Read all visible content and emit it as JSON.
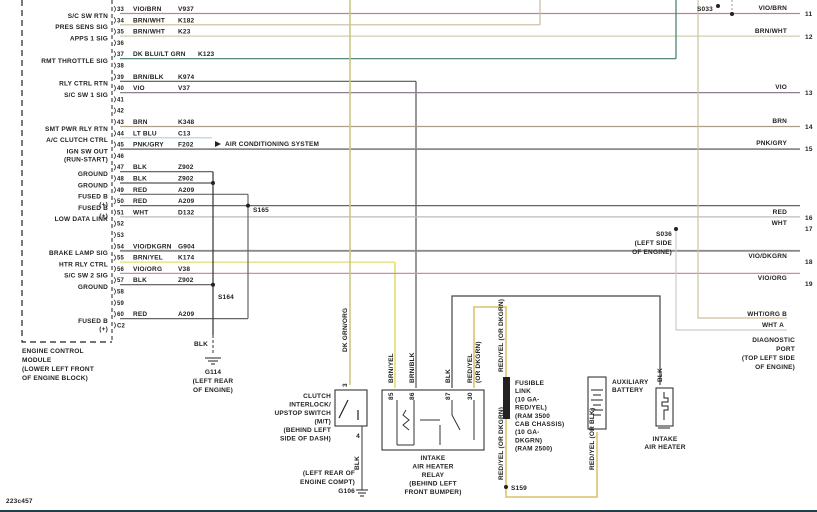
{
  "ecm": {
    "pins": [
      {
        "pin": "33",
        "name": "",
        "wire": "VIO/BRN",
        "circuit": "V937",
        "hex": "#b4869c"
      },
      {
        "pin": "34",
        "name": "S/C SW RTN",
        "wire": "BRN/WHT",
        "circuit": "K182",
        "hex": "#c9bc9c"
      },
      {
        "pin": "35",
        "name": "PRES SENS SIG",
        "wire": "BRN/WHT",
        "circuit": "K23",
        "hex": "#d6ccb4"
      },
      {
        "pin": "36",
        "name": "APPS 1 SIG",
        "wire": "",
        "circuit": "",
        "hex": ""
      },
      {
        "pin": "37",
        "name": "",
        "wire": "DK BLU/LT GRN",
        "circuit": "K123",
        "hex": "#3f7a6a"
      },
      {
        "pin": "38",
        "name": "RMT THROTTLE SIG",
        "wire": "",
        "circuit": "",
        "hex": ""
      },
      {
        "pin": "39",
        "name": "",
        "wire": "BRN/BLK",
        "circuit": "K974",
        "hex": "#555555"
      },
      {
        "pin": "40",
        "name": "RLY CTRL RTN",
        "wire": "VIO",
        "circuit": "V37",
        "hex": "#8e7f8e"
      },
      {
        "pin": "41",
        "name": "S/C SW 1 SIG",
        "wire": "",
        "circuit": "",
        "hex": ""
      },
      {
        "pin": "42",
        "name": "",
        "wire": "",
        "circuit": "",
        "hex": ""
      },
      {
        "pin": "43",
        "name": "",
        "wire": "BRN",
        "circuit": "K348",
        "hex": "#ab9e8c"
      },
      {
        "pin": "44",
        "name": "SMT PWR RLY RTN",
        "wire": "LT BLU",
        "circuit": "C13",
        "hex": "#a6d2da"
      },
      {
        "pin": "45",
        "name": "A/C CLUTCH CTRL",
        "wire": "PNK/GRY",
        "circuit": "F202",
        "hex": "#8a8a8a"
      },
      {
        "pin": "46",
        "name": "IGN SW OUT (RUN-START)",
        "wire": "",
        "circuit": "",
        "hex": ""
      },
      {
        "pin": "47",
        "name": "",
        "wire": "BLK",
        "circuit": "Z902",
        "hex": "#555555"
      },
      {
        "pin": "48",
        "name": "GROUND",
        "wire": "BLK",
        "circuit": "Z902",
        "hex": "#555555"
      },
      {
        "pin": "49",
        "name": "GROUND",
        "wire": "RED",
        "circuit": "A209",
        "hex": "#666666"
      },
      {
        "pin": "50",
        "name": "FUSED B(+)",
        "wire": "RED",
        "circuit": "A209",
        "hex": "#666666"
      },
      {
        "pin": "51",
        "name": "FUSED B(+)",
        "wire": "WHT",
        "circuit": "D132",
        "hex": "#bbbbbb"
      },
      {
        "pin": "52",
        "name": "LOW DATA LINK",
        "wire": "",
        "circuit": "",
        "hex": ""
      },
      {
        "pin": "53",
        "name": "",
        "wire": "",
        "circuit": "",
        "hex": ""
      },
      {
        "pin": "54",
        "name": "",
        "wire": "VIO/DKGRN",
        "circuit": "G904",
        "hex": "#8a8a8a"
      },
      {
        "pin": "55",
        "name": "BRAKE LAMP SIG",
        "wire": "BRN/YEL",
        "circuit": "K174",
        "hex": "#e4de6e"
      },
      {
        "pin": "56",
        "name": "HTR RLY CTRL",
        "wire": "VIO/ORG",
        "circuit": "V38",
        "hex": "#c492aa"
      },
      {
        "pin": "57",
        "name": "S/C SW 2 SIG",
        "wire": "BLK",
        "circuit": "Z902",
        "hex": "#555555"
      },
      {
        "pin": "58",
        "name": "GROUND",
        "wire": "",
        "circuit": "",
        "hex": ""
      },
      {
        "pin": "59",
        "name": "",
        "wire": "",
        "circuit": "",
        "hex": ""
      },
      {
        "pin": "60",
        "name": "",
        "wire": "RED",
        "circuit": "A209",
        "hex": "#666666"
      },
      {
        "pin": "C2",
        "name": "FUSED B(+)",
        "wire": "",
        "circuit": "",
        "hex": ""
      }
    ],
    "label": [
      "ENGINE CONTROL",
      "MODULE",
      "(LOWER LEFT FRONT",
      "OF ENGINE BLOCK)"
    ]
  },
  "ac_system": "AIR CONDITIONING SYSTEM",
  "right_connectors": [
    {
      "num": "11",
      "wire": "VIO/BRN"
    },
    {
      "num": "12",
      "wire": "BRN/WHT"
    },
    {
      "num": "13",
      "wire": "VIO"
    },
    {
      "num": "14",
      "wire": "BRN"
    },
    {
      "num": "15",
      "wire": "PNK/GRY"
    },
    {
      "num": "16",
      "wire": "RED"
    },
    {
      "num": "17",
      "wire": "WHT"
    },
    {
      "num": "18",
      "wire": "VIO/DKGRN"
    },
    {
      "num": "19",
      "wire": "VIO/ORG"
    }
  ],
  "splices": {
    "s033": "S033",
    "s165": "S165",
    "s164": "S164",
    "s036": "S036",
    "s036_loc": [
      "(LEFT SIDE",
      "OF ENGINE)"
    ],
    "s159": "S159"
  },
  "diag_port": {
    "pin_b": "WHT/ORG  B",
    "pin_a": "WHT  A",
    "label": [
      "DIAGNOSTIC",
      "PORT",
      "(TOP LEFT SIDE",
      "OF ENGINE)"
    ]
  },
  "ground_g114": {
    "wire": "BLK",
    "name": "G114",
    "loc": [
      "(LEFT REAR",
      "OF ENGINE)"
    ]
  },
  "clutch": {
    "wire": "DK GRN/ORG",
    "pin_top": "3",
    "pin_bot": "4",
    "wire_bot": "BLK",
    "label": [
      "CLUTCH",
      "INTERLOCK/",
      "UPSTOP SWITCH",
      "(M/T)",
      "(BEHIND LEFT",
      "SIDE OF DASH)"
    ]
  },
  "ground_g106": {
    "name": "G106",
    "loc": [
      "(LEFT REAR OF",
      "ENGINE COMPT)"
    ]
  },
  "relay": {
    "pins": [
      {
        "pin": "85",
        "wire": "BRN/YEL"
      },
      {
        "pin": "86",
        "wire": "BRN/BLK"
      },
      {
        "pin": "87",
        "wire": "BLK"
      },
      {
        "pin": "30",
        "wire": "RED/YEL (OR DKGRN)"
      }
    ],
    "label": [
      "INTAKE",
      "AIR HEATER",
      "RELAY",
      "(BEHIND LEFT",
      "FRONT BUMPER)"
    ]
  },
  "fusible": {
    "wire_top": "RED/YEL (OR DKGRN)",
    "wire_bot": "RED/YEL (OR DKGRN)",
    "label": [
      "FUSIBLE",
      "LINK",
      "(10 GA-",
      "RED/YEL)",
      "(RAM 3500",
      "CAB CHASSIS)",
      "(10 GA-",
      "DKGRN)",
      "(RAM 2500)"
    ]
  },
  "battery": {
    "label": [
      "AUXILIARY",
      "BATTERY"
    ],
    "wire": "RED/YEL (OR BLK)"
  },
  "heater": {
    "wire": "BLK",
    "label": [
      "INTAKE",
      "AIR HEATER"
    ]
  },
  "figure_id": "223c457"
}
